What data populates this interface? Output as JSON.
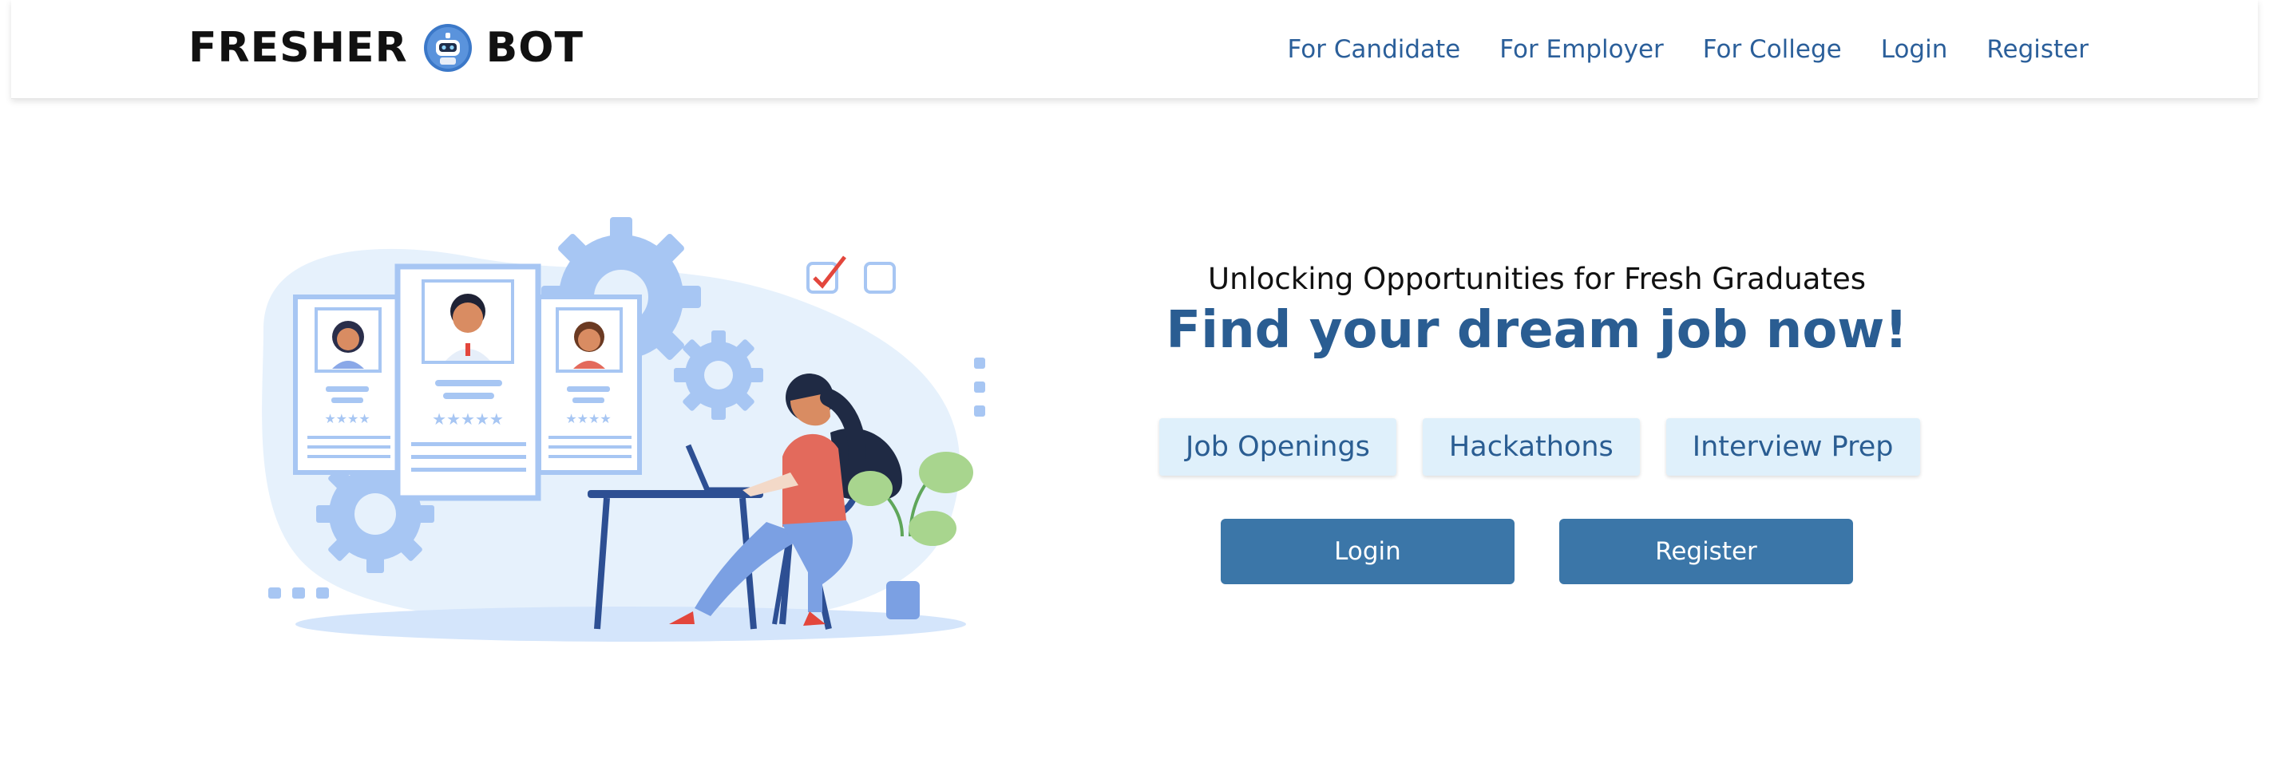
{
  "brand": {
    "name_left": "FRESHER",
    "name_right": "BOT",
    "icon": "robot-icon"
  },
  "nav": {
    "items": [
      {
        "label": "For Candidate"
      },
      {
        "label": "For Employer"
      },
      {
        "label": "For College"
      },
      {
        "label": "Login"
      },
      {
        "label": "Register"
      }
    ]
  },
  "hero": {
    "tagline": "Unlocking Opportunities for Fresh Graduates",
    "headline": "Find your dream job now!",
    "pills": [
      {
        "label": "Job Openings"
      },
      {
        "label": "Hackathons"
      },
      {
        "label": "Interview Prep"
      }
    ],
    "login_label": "Login",
    "register_label": "Register"
  },
  "illustration": {
    "icon": "job-search-illustration"
  },
  "colors": {
    "accent": "#2a5d92",
    "button": "#3b76a8",
    "pill_bg": "#dff0fb",
    "illustration_light": "#e6f1fc",
    "illustration_mid": "#a7c6f3"
  }
}
